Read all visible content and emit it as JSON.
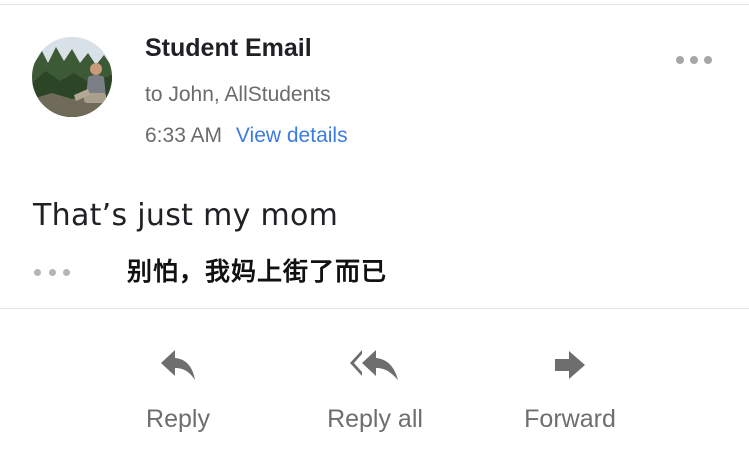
{
  "message": {
    "sender_name": "Student Email",
    "recipients": "to John, AllStudents",
    "time": "6:33 AM",
    "view_details": "View details",
    "body": "That’s just my mom",
    "subtitle": "别怕，我妈上街了而已"
  },
  "actions": {
    "reply": "Reply",
    "reply_all": "Reply all",
    "forward": "Forward"
  },
  "colors": {
    "link": "#3b7de0",
    "secondary_text": "#6b6b6b",
    "icon": "#6e6e6e"
  },
  "icons": [
    "more-horizontal-icon",
    "expand-quoted-icon",
    "reply-icon",
    "reply-all-icon",
    "forward-icon"
  ]
}
